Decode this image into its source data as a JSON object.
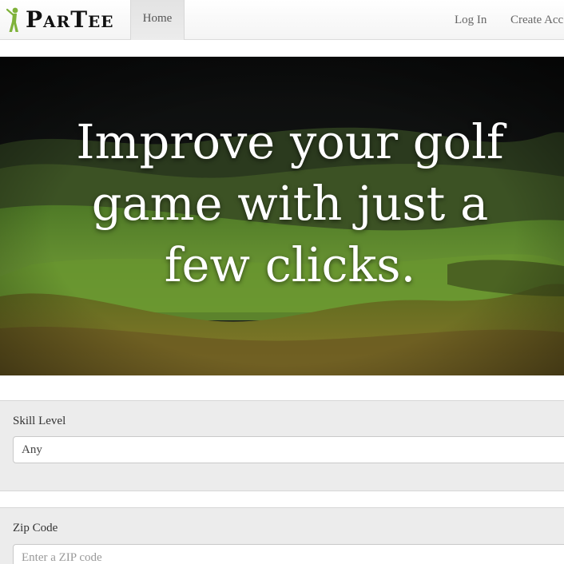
{
  "navbar": {
    "brand": "ParTee",
    "logo_icon": "golfer-icon",
    "home_label": "Home",
    "login_label": "Log In",
    "create_label": "Create Acc"
  },
  "hero": {
    "headline": "Improve your golf game with just a few clicks."
  },
  "search": {
    "skill": {
      "label": "Skill Level",
      "value": "Any"
    },
    "zip": {
      "label": "Zip Code",
      "placeholder": "Enter a ZIP code"
    }
  },
  "colors": {
    "brand_green": "#7fb23a",
    "hero_dark": "#1c2414",
    "panel_bg": "#ececec"
  }
}
